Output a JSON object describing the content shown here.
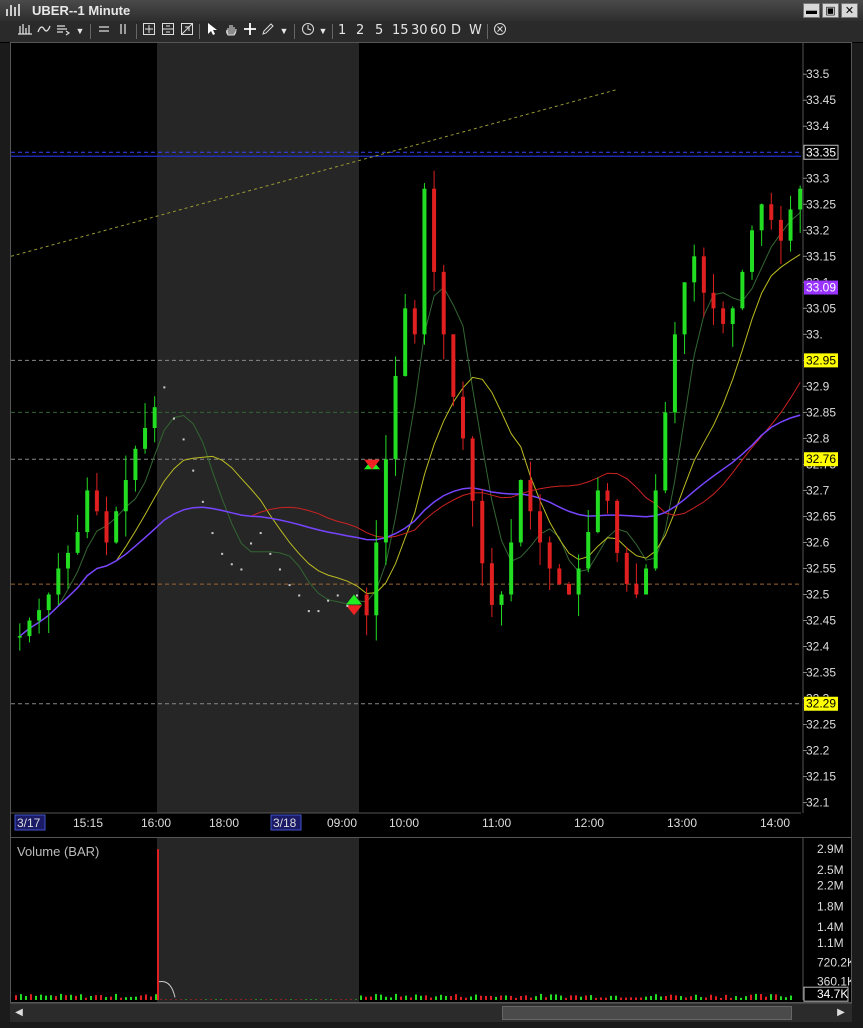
{
  "window": {
    "title": "UBER--1 Minute",
    "minimize_label": "▬",
    "restore_label": "▣",
    "close_label": "✕"
  },
  "toolbar": {
    "periods": [
      "1",
      "2",
      "5",
      "15",
      "30",
      "60",
      "D",
      "W"
    ],
    "dropdown_glyph": "▼"
  },
  "price_axis": {
    "ticks": [
      "33.5",
      "33.45",
      "33.4",
      "33.35",
      "33.3",
      "33.25",
      "33.2",
      "33.15",
      "33.1",
      "33.05",
      "33.",
      "32.95",
      "32.9",
      "32.85",
      "32.8",
      "32.75",
      "32.7",
      "32.65",
      "32.6",
      "32.55",
      "32.5",
      "32.45",
      "32.4",
      "32.35",
      "32.3",
      "32.25",
      "32.2",
      "32.15",
      "32.1"
    ],
    "tick_values": [
      33.5,
      33.45,
      33.4,
      33.35,
      33.3,
      33.25,
      33.2,
      33.15,
      33.1,
      33.05,
      33.0,
      32.95,
      32.9,
      32.85,
      32.8,
      32.75,
      32.7,
      32.65,
      32.6,
      32.55,
      32.5,
      32.45,
      32.4,
      32.35,
      32.3,
      32.25,
      32.2,
      32.15,
      32.1
    ],
    "markers": [
      {
        "label": "33.35",
        "value": 33.35,
        "style": "outlined"
      },
      {
        "label": "33.09",
        "value": 33.09,
        "style": "purple"
      },
      {
        "label": "32.95",
        "value": 32.95,
        "style": "yellow"
      },
      {
        "label": "32.76",
        "value": 32.76,
        "style": "yellow"
      },
      {
        "label": "32.29",
        "value": 32.29,
        "style": "yellow"
      }
    ]
  },
  "time_axis": {
    "labels": [
      "3/17",
      "15:15",
      "16:00",
      "18:00",
      "3/18",
      "09:00",
      "10:00",
      "11:00",
      "12:00",
      "13:00",
      "14:00"
    ],
    "highlighted": [
      "3/17",
      "3/18"
    ]
  },
  "volume": {
    "title": "Volume (BAR)",
    "ticks": [
      "2.9M",
      "2.5M",
      "2.2M",
      "1.8M",
      "1.4M",
      "1.1M",
      "720.2K",
      "360.1K"
    ],
    "tick_values": [
      2.9,
      2.5,
      2.2,
      1.8,
      1.4,
      1.1,
      0.7202,
      0.3601
    ],
    "last_label": "34.7K",
    "last_value": 0.0347
  },
  "colors": {
    "up": "#22dd22",
    "down": "#e02020",
    "yellow_label": "#ffff00",
    "purple_label": "#9933ff",
    "vwap": "#7744ff",
    "ma_slow": "#cc2222",
    "ma_mid": "#bbbb22",
    "session_shade": "#262626"
  },
  "chart_data": {
    "type": "candlestick",
    "y_range": [
      32.08,
      33.56
    ],
    "horizontal_levels": [
      33.35,
      32.95,
      32.85,
      32.76,
      32.52,
      32.29
    ],
    "x_session_labels": [
      "3/17",
      "15:15",
      "16:00",
      "18:00",
      "3/18",
      "09:00",
      "10:00",
      "11:00",
      "12:00",
      "13:00",
      "14:00"
    ],
    "close_path": [
      32.42,
      32.45,
      32.47,
      32.5,
      32.55,
      32.58,
      32.62,
      32.7,
      32.66,
      32.6,
      32.66,
      32.72,
      32.78,
      32.82,
      32.86,
      32.9,
      32.84,
      32.8,
      32.74,
      32.68,
      32.62,
      32.58,
      32.56,
      32.55,
      32.6,
      32.62,
      32.58,
      32.55,
      32.52,
      32.5,
      32.47,
      32.47,
      32.49,
      32.5,
      32.48,
      32.5,
      32.46,
      32.6,
      32.76,
      32.92,
      33.05,
      33.0,
      33.28,
      33.12,
      33.0,
      32.88,
      32.8,
      32.68,
      32.56,
      32.48,
      32.5,
      32.6,
      32.72,
      32.66,
      32.6,
      32.55,
      32.52,
      32.5,
      32.55,
      32.62,
      32.7,
      32.68,
      32.58,
      32.52,
      32.5,
      32.55,
      32.7,
      32.85,
      33.0,
      33.1,
      33.15,
      33.08,
      33.05,
      33.02,
      33.05,
      33.12,
      33.2,
      33.25,
      33.22,
      33.18,
      33.24,
      33.28
    ]
  }
}
